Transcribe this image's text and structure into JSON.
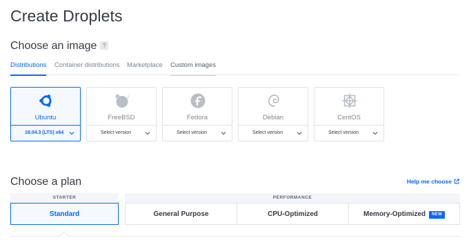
{
  "page": {
    "title": "Create Droplets"
  },
  "image_section": {
    "title": "Choose an image",
    "help": "?",
    "tabs": [
      "Distributions",
      "Container distributions",
      "Marketplace",
      "Custom images"
    ],
    "active_tab": "Distributions",
    "distributions": [
      {
        "name": "Ubuntu",
        "version": "18.04.3 (LTS) x64",
        "selected": true,
        "icon": "ubuntu-icon"
      },
      {
        "name": "FreeBSD",
        "version": "Select version",
        "selected": false,
        "icon": "freebsd-icon"
      },
      {
        "name": "Fedora",
        "version": "Select version",
        "selected": false,
        "icon": "fedora-icon"
      },
      {
        "name": "Debian",
        "version": "Select version",
        "selected": false,
        "icon": "debian-icon"
      },
      {
        "name": "CentOS",
        "version": "Select version",
        "selected": false,
        "icon": "centos-icon"
      }
    ]
  },
  "plan_section": {
    "title": "Choose a plan",
    "help_link": "Help me choose",
    "groups": {
      "starter": "STARTER",
      "performance": "PERFORMANCE"
    },
    "plans": [
      {
        "label": "Standard",
        "selected": true
      },
      {
        "label": "General Purpose",
        "selected": false
      },
      {
        "label": "CPU-Optimized",
        "selected": false
      },
      {
        "label": "Memory-Optimized",
        "selected": false,
        "badge": "NEW"
      }
    ]
  },
  "colors": {
    "accent": "#0069ff",
    "border": "#dfe2e6",
    "muted": "#7d8590",
    "text": "#333a45"
  }
}
